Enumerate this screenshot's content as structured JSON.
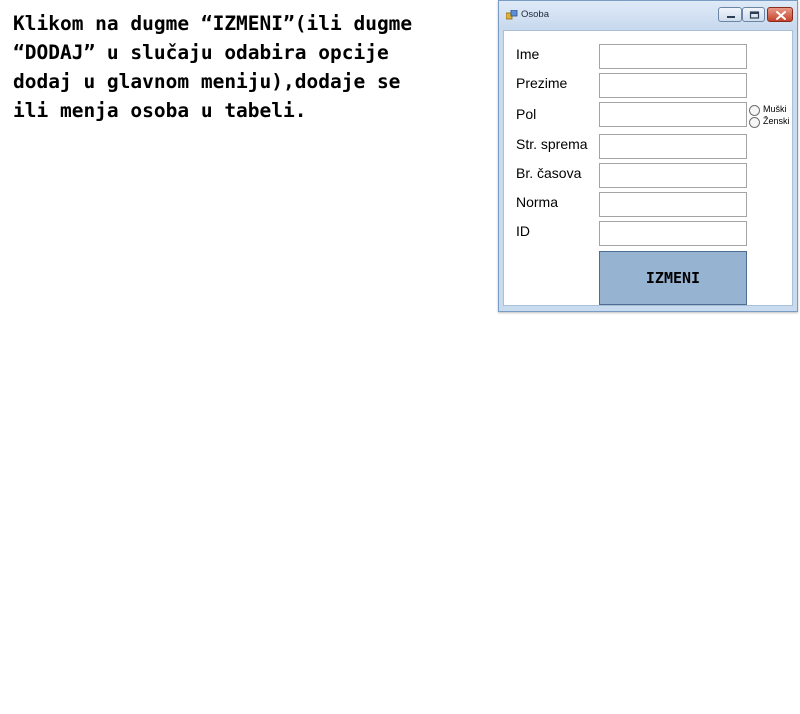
{
  "instruction_text": "Klikom na dugme “IZMENI”(ili dugme\n“DODAJ” u slučaju odabira opcije\ndodaj u glavnom meniju),dodaje se\nili menja osoba u tabeli.",
  "window": {
    "title": "Osoba",
    "controls": [
      "minimize-icon",
      "maximize-icon",
      "close-icon"
    ]
  },
  "form": {
    "fields": {
      "ime": {
        "label": "Ime",
        "value": ""
      },
      "prezime": {
        "label": "Prezime",
        "value": ""
      },
      "pol": {
        "label": "Pol",
        "value": ""
      },
      "sprema": {
        "label": "Str. sprema",
        "value": ""
      },
      "casova": {
        "label": "Br. časova",
        "value": ""
      },
      "norma": {
        "label": "Norma",
        "value": ""
      },
      "id": {
        "label": "ID",
        "value": ""
      }
    },
    "gender_options": {
      "male": "Muški",
      "female": "Ženski"
    },
    "submit_label": "IZMENI"
  },
  "colors": {
    "button_fill": "#96b3d2",
    "window_frame": "#c9dbef",
    "close_button": "#c4432b"
  }
}
